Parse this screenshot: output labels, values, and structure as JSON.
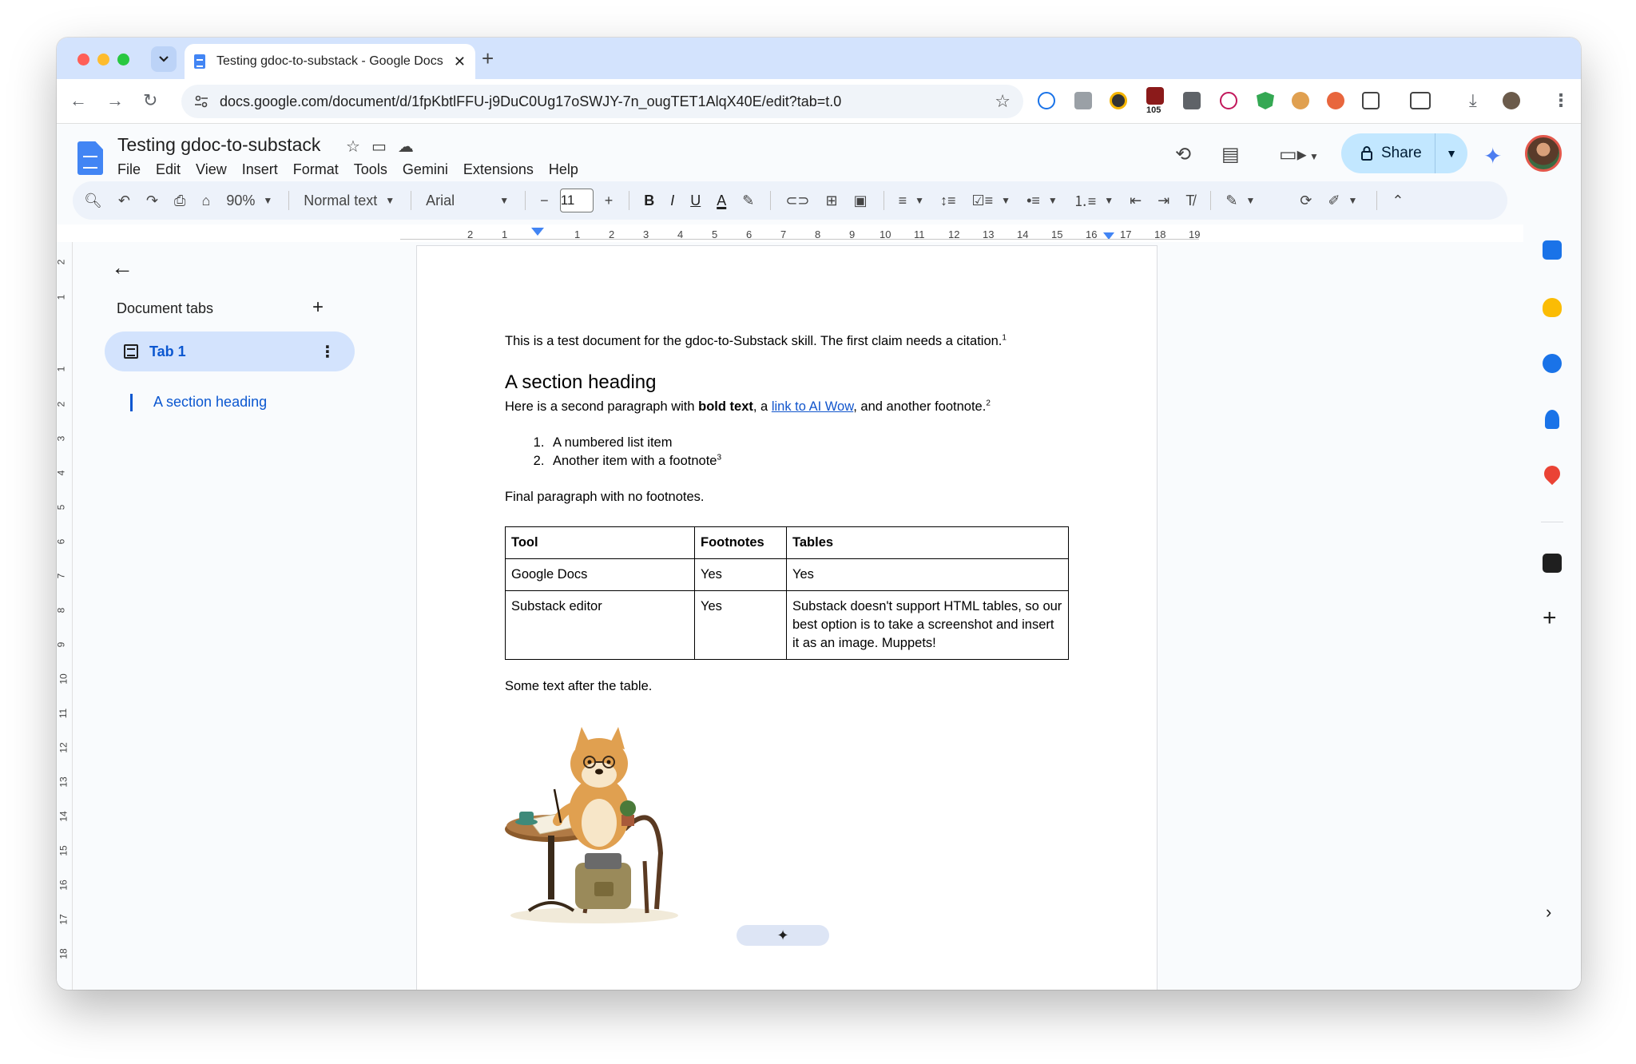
{
  "browser": {
    "tab_title": "Testing gdoc-to-substack - Google Docs",
    "url": "docs.google.com/document/d/1fpKbtlFFU-j9DuC0Ug17oSWJY-7n_ougTET1AlqX40E/edit?tab=t.0",
    "extension_badge": "105"
  },
  "docs": {
    "title": "Testing gdoc-to-substack",
    "menu": [
      "File",
      "Edit",
      "View",
      "Insert",
      "Format",
      "Tools",
      "Gemini",
      "Extensions",
      "Help"
    ],
    "share_label": "Share"
  },
  "format_toolbar": {
    "zoom": "90%",
    "style": "Normal text",
    "font": "Arial",
    "font_size": "11"
  },
  "ruler": {
    "h_ticks": [
      "2",
      "1",
      "1",
      "2",
      "3",
      "4",
      "5",
      "6",
      "7",
      "8",
      "9",
      "10",
      "11",
      "12",
      "13",
      "14",
      "15",
      "16",
      "17",
      "18",
      "19"
    ],
    "v_ticks": [
      "2",
      "1",
      "1",
      "2",
      "3",
      "4",
      "5",
      "6",
      "7",
      "8",
      "9",
      "10",
      "11",
      "12",
      "13",
      "14",
      "15",
      "16",
      "17",
      "18"
    ]
  },
  "side_panel": {
    "header": "Document tabs",
    "tab_label": "Tab 1",
    "outline_item": "A section heading"
  },
  "document": {
    "p1": "This is a test document for the gdoc-to-Substack skill. The first claim needs a citation.",
    "p1_fn": "1",
    "heading": "A section heading",
    "p2_a": "Here is a second paragraph with ",
    "p2_bold": "bold text",
    "p2_b": ", a ",
    "p2_link": "link to AI Wow",
    "p2_c": ", and another footnote.",
    "p2_fn": "2",
    "list": [
      "A numbered list item",
      "Another item with a footnote"
    ],
    "list_fn": "3",
    "p3": "Final paragraph with no footnotes.",
    "table": {
      "headers": [
        "Tool",
        "Footnotes",
        "Tables"
      ],
      "rows": [
        [
          "Google Docs",
          "Yes",
          "Yes"
        ],
        [
          "Substack editor",
          "Yes",
          "Substack doesn't support HTML tables, so our best option is to take a screenshot and insert it as an image. Muppets!"
        ]
      ]
    },
    "p4": "Some text after the table."
  },
  "colors": {
    "tab_strip": "#d3e3fd",
    "accent_blue": "#0b57d0",
    "share_bg": "#c2e7ff",
    "link": "#1155cc"
  },
  "icons": {
    "rail": [
      "calendar-icon",
      "keep-icon",
      "tasks-icon",
      "contacts-icon",
      "maps-icon",
      "figma-icon"
    ]
  }
}
